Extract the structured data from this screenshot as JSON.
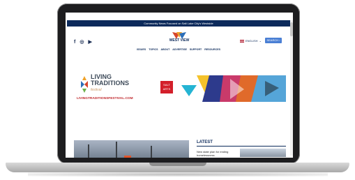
{
  "topbar": {
    "text": "Community News Focused on Salt Lake City's Westside"
  },
  "header": {
    "logo_text": "WEST VIEW",
    "social": [
      "f",
      "◎",
      "▶"
    ],
    "language": "ENGLISH",
    "language_caret": "⌄",
    "search_label": "SEARCH ›",
    "nav": [
      "ISSUES",
      "TOPICS",
      "ABOUT",
      "ADVERTISE",
      "SUPPORT",
      "RESOURCES"
    ]
  },
  "ad": {
    "title_line1": "LIVING",
    "title_line2": "TRADITIONS",
    "subtitle": "festival",
    "url": "LIVINGTRADITIONSFESTIVAL.COM",
    "badge_line1": "SALT",
    "badge_line2": "ARTS"
  },
  "sidebar": {
    "heading": "LATEST",
    "story_title": "New state plan for ending homelessness"
  },
  "colors": {
    "navy": "#0c2a5b",
    "accent_red": "#c0282d",
    "search_blue": "#4a7fd4"
  }
}
